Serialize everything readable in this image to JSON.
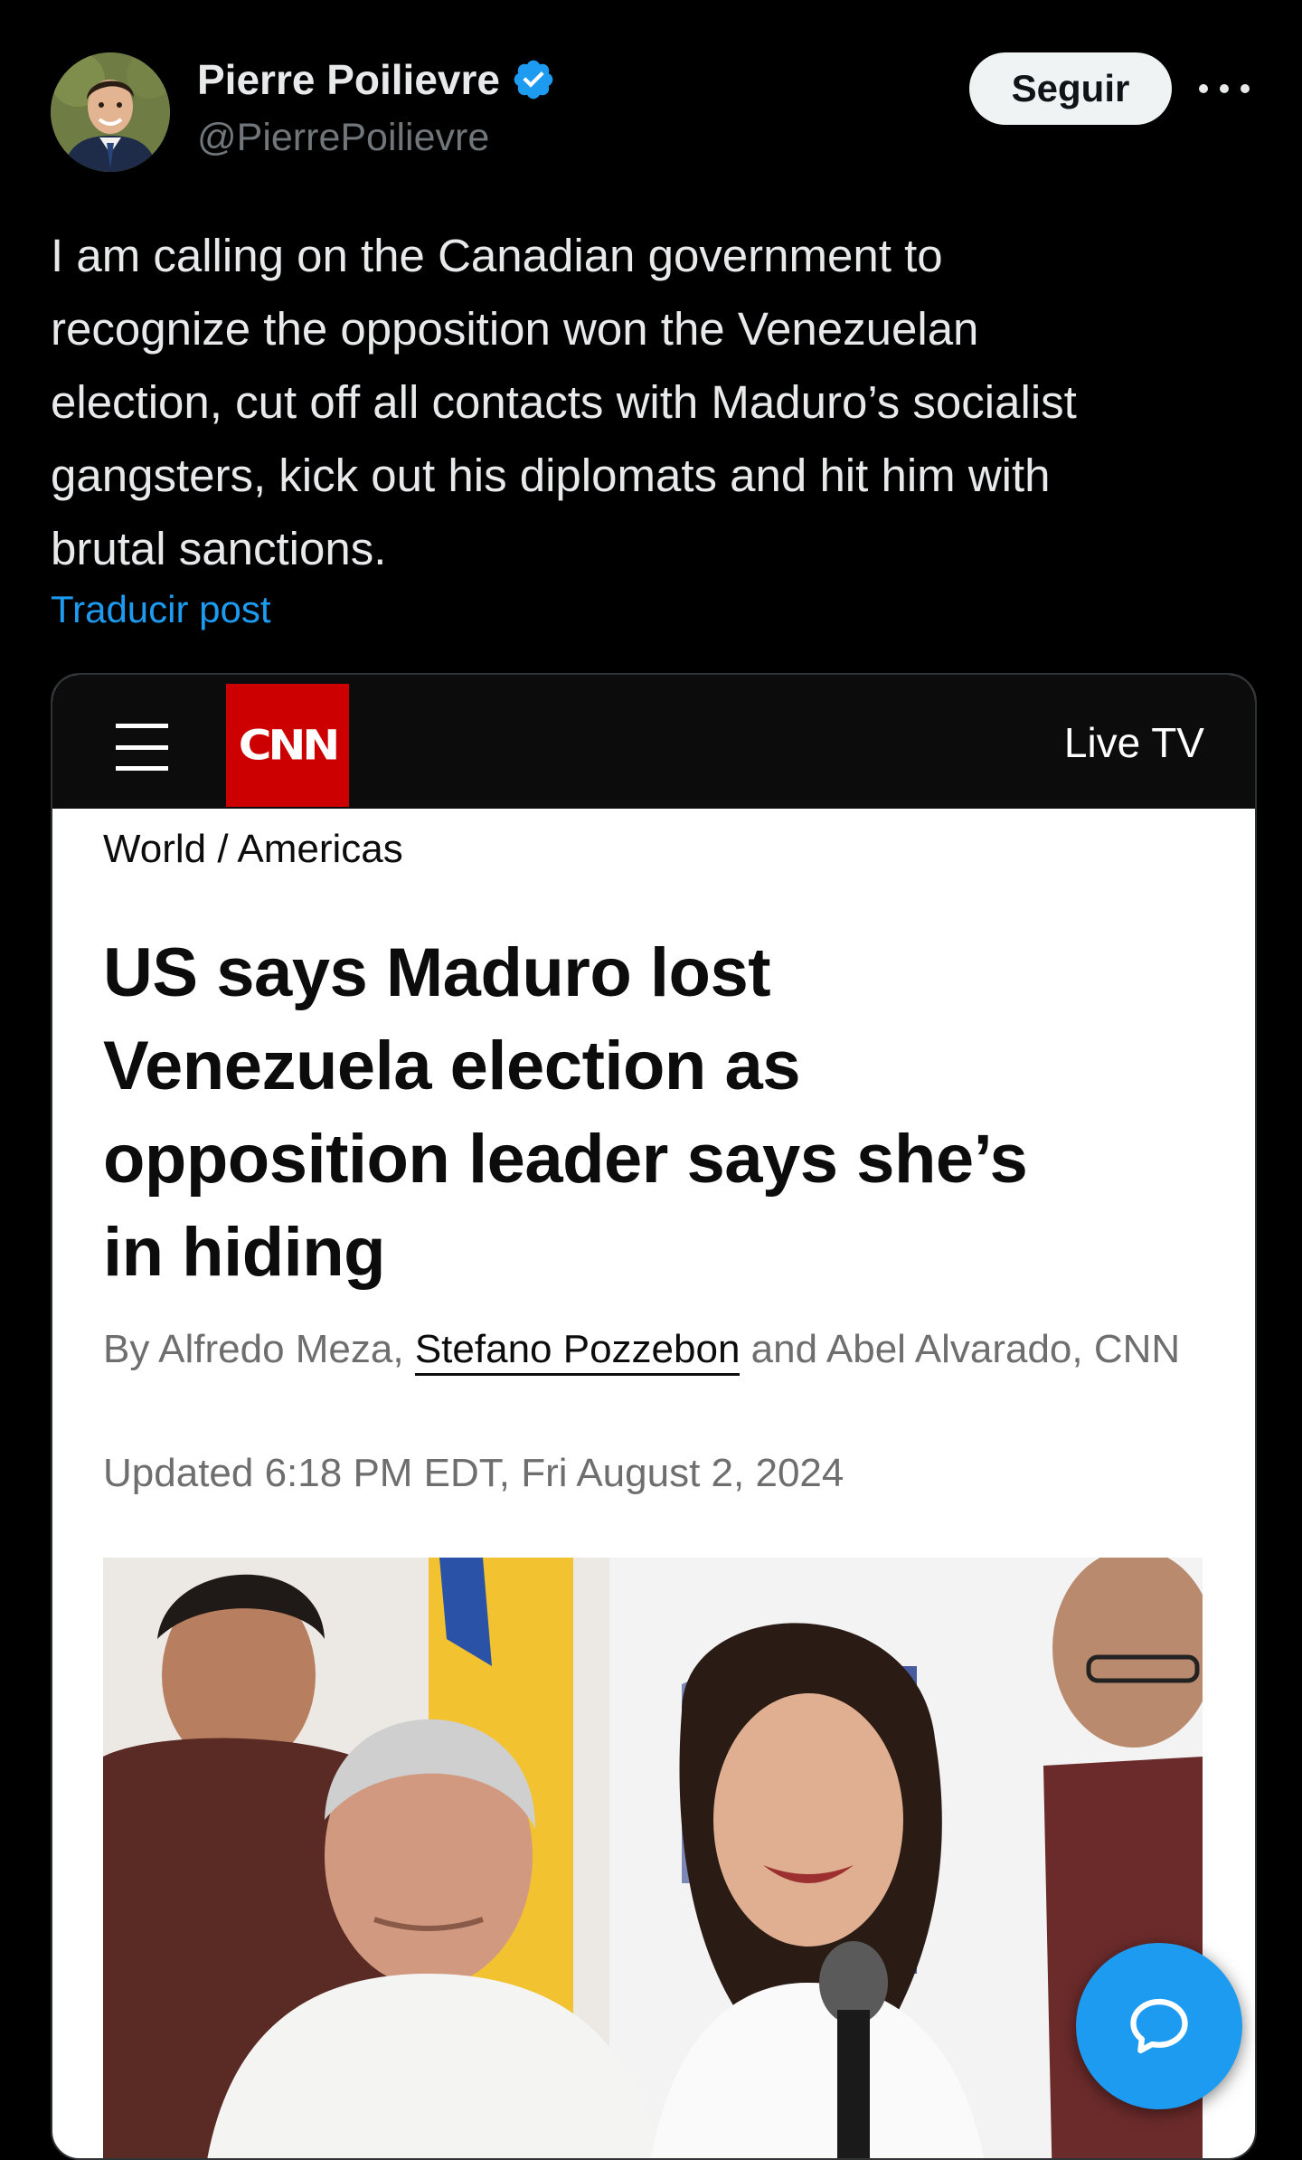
{
  "author": {
    "name": "Pierre Poilievre",
    "handle": "@PierrePoilievre",
    "verified": true,
    "avatar_icon": "profile-photo"
  },
  "actions": {
    "follow_label": "Seguir",
    "more_icon": "ellipsis-icon"
  },
  "post": {
    "text": "I am calling on the Canadian government to\nrecognize the opposition won the Venezuelan\nelection, cut off all contacts with Maduro’s socialist\ngangsters, kick out his diplomats and hit him with\nbrutal sanctions.",
    "translate_label": "Traducir post"
  },
  "article": {
    "header": {
      "menu_icon": "hamburger-menu-icon",
      "logo_text": "CNN",
      "live_tv": "Live TV"
    },
    "breadcrumb": "World / Americas",
    "headline": "US says Maduro lost\nVenezuela election as\nopposition leader says she’s\nin hiding",
    "byline": {
      "prefix": "By Alfredo Meza, ",
      "linked_author": "Stefano Pozzebon",
      "suffix": " and Abel Alvarado, CNN"
    },
    "updated": "Updated 6:18 PM EDT, Fri August 2, 2024",
    "photo_icon": "news-photo"
  },
  "fab": {
    "icon": "chat-bubble-icon"
  },
  "colors": {
    "background": "#000000",
    "text_primary": "#e7e9ea",
    "text_secondary": "#71767b",
    "link_blue": "#1d9bf0",
    "verified_blue": "#1d9bf0",
    "cnn_red": "#cc0000"
  }
}
